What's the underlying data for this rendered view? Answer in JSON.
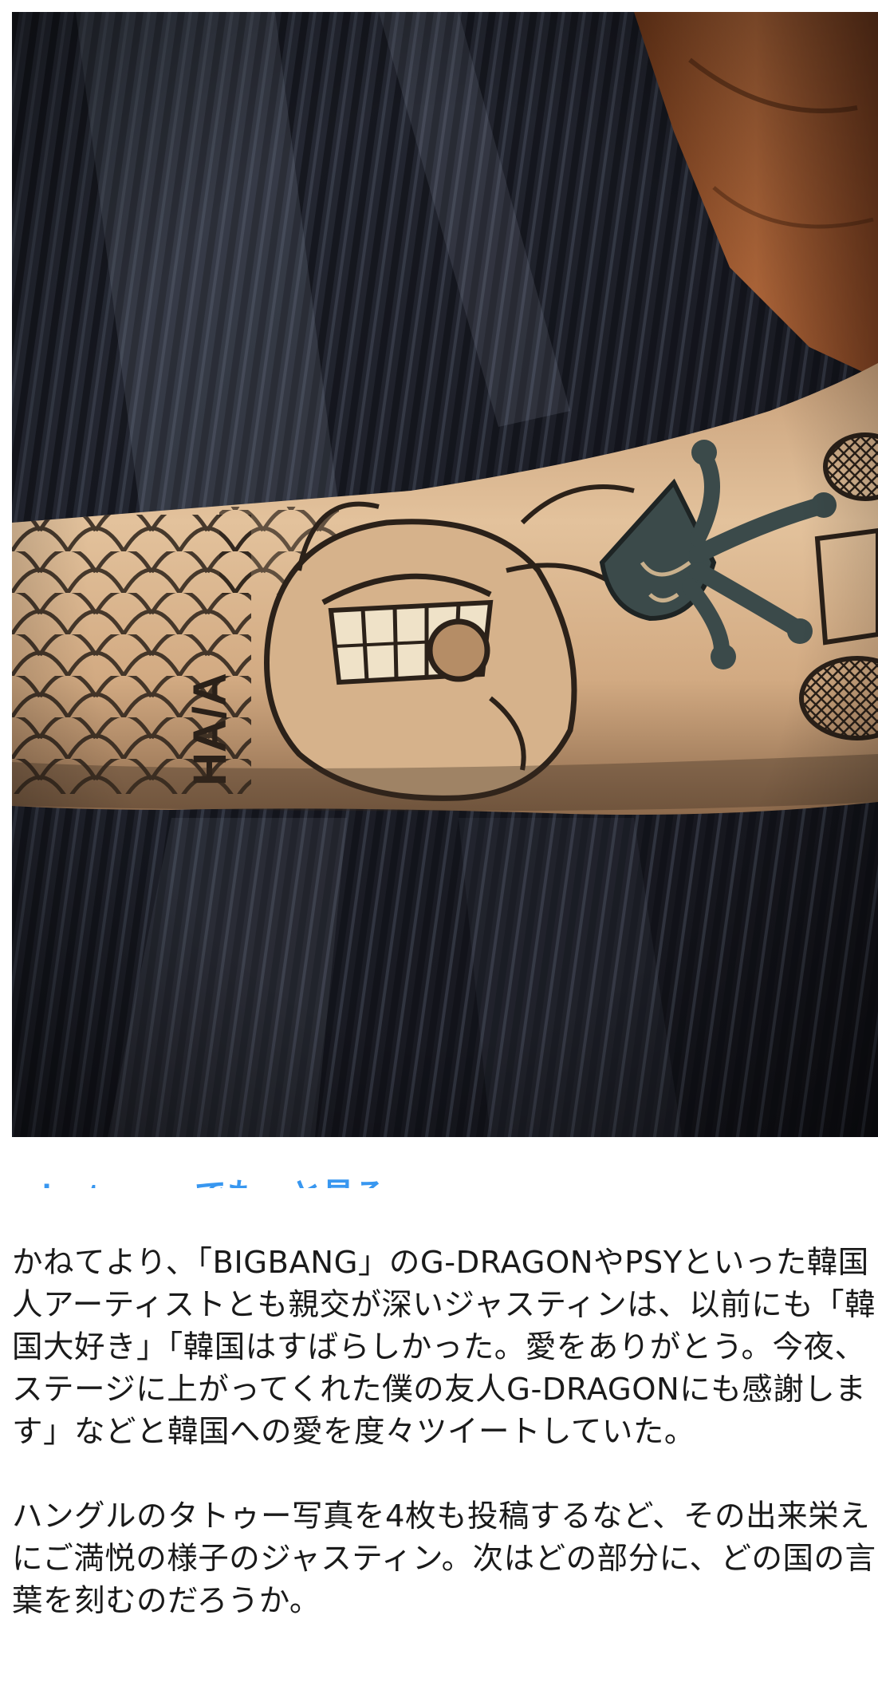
{
  "photo": {
    "alt": "tattoo-on-forearm",
    "tattoo_text": "HA/A"
  },
  "instagram_link": {
    "label": "Instagramでもっと見る"
  },
  "article": {
    "paragraphs": [
      "かねてより、「BIGBANG」のG-DRAGONやPSYといった韓国人アーティストとも親交が深いジャスティンは、以前にも「韓国大好き」「韓国はすばらしかった。愛をありがとう。今夜、ステージに上がってくれた僕の友人G-DRAGONにも感謝します」などと韓国への愛を度々ツイートしていた。",
      "ハングルのタトゥー写真を4枚も投稿するなど、その出来栄えにご満悦の様子のジャスティン。次はどの部分に、どの国の言葉を刻むのだろうか。"
    ]
  },
  "colors": {
    "link": "#3897f0",
    "text": "#1a1a1a",
    "background": "#ffffff"
  }
}
